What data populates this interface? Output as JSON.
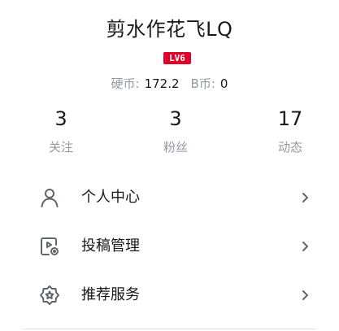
{
  "profile": {
    "username": "剪水作花飞LQ",
    "level_badge": "LV6",
    "coins_label": "硬币:",
    "coins_value": "172.2",
    "bcoins_label": "B币:",
    "bcoins_value": "0"
  },
  "stats": [
    {
      "value": "3",
      "label": "关注"
    },
    {
      "value": "3",
      "label": "粉丝"
    },
    {
      "value": "17",
      "label": "动态"
    }
  ],
  "menu": [
    {
      "label": "个人中心",
      "icon": "person-icon"
    },
    {
      "label": "投稿管理",
      "icon": "upload-manage-icon"
    },
    {
      "label": "推荐服务",
      "icon": "star-badge-icon"
    }
  ],
  "colors": {
    "badge_red": "#e0002a",
    "text_primary": "#18191c",
    "text_secondary": "#9499a0",
    "icon_gray": "#61666d"
  }
}
